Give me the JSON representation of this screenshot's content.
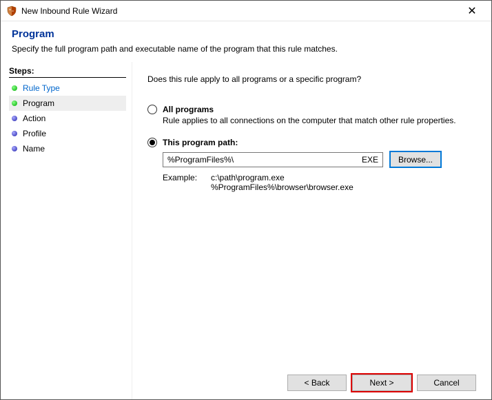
{
  "window": {
    "title": "New Inbound Rule Wizard"
  },
  "header": {
    "title": "Program",
    "description": "Specify the full program path and executable name of the program that this rule matches."
  },
  "sidebar": {
    "label": "Steps:",
    "items": [
      {
        "label": "Rule Type"
      },
      {
        "label": "Program"
      },
      {
        "label": "Action"
      },
      {
        "label": "Profile"
      },
      {
        "label": "Name"
      }
    ]
  },
  "main": {
    "question": "Does this rule apply to all programs or a specific program?",
    "option_all": {
      "label": "All programs",
      "desc": "Rule applies to all connections on the computer that match other rule properties."
    },
    "option_path": {
      "label": "This program path:",
      "value": "%ProgramFiles%\\",
      "ext": "EXE",
      "browse": "Browse...",
      "example_label": "Example:",
      "example_1": "c:\\path\\program.exe",
      "example_2": "%ProgramFiles%\\browser\\browser.exe"
    }
  },
  "footer": {
    "back": "< Back",
    "next": "Next >",
    "cancel": "Cancel"
  }
}
